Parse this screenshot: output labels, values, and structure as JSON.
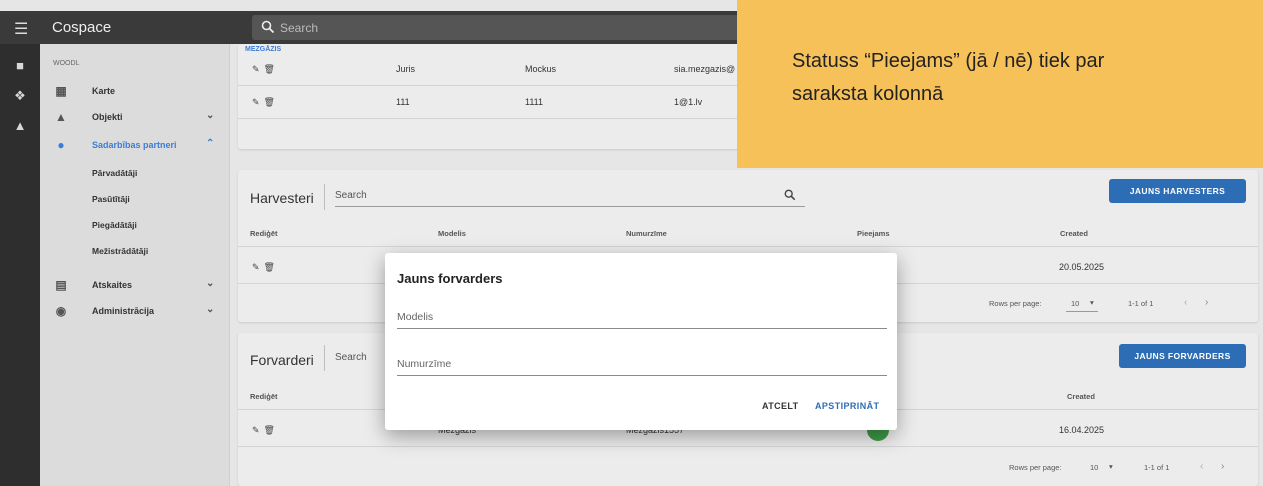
{
  "app": {
    "title": "Cospace",
    "search_placeholder": "Search"
  },
  "sidebar": {
    "org": "WOODL",
    "items": [
      {
        "label": "Karte",
        "icon": "map-icon"
      },
      {
        "label": "Objekti",
        "icon": "tree-icon"
      },
      {
        "label": "Sadarbības partneri",
        "icon": "partners-icon"
      },
      {
        "label": "Atskaites",
        "icon": "report-icon"
      },
      {
        "label": "Administrācija",
        "icon": "account-icon"
      }
    ],
    "subitems": [
      "Pārvadātāji",
      "Pasūtītāji",
      "Piegādātāji",
      "Mežistrādātāji"
    ]
  },
  "top_table": {
    "group_label": "MEZGĀZIS",
    "rows": [
      {
        "c1": "Juris",
        "c2": "Mockus",
        "c3": "sia.mezgazis@"
      },
      {
        "c1": "111",
        "c2": "1111",
        "c3": "1@1.lv"
      }
    ]
  },
  "harvesteri": {
    "title": "Harvesteri",
    "search": "Search",
    "button": "JAUNS HARVESTERS",
    "headers": {
      "edit": "Rediģēt",
      "model": "Modelis",
      "number": "Numurzīme",
      "available": "Pieejams",
      "created": "Created"
    },
    "rows": [
      {
        "created": "20.05.2025"
      }
    ],
    "pager": {
      "rows_per_page": "Rows per page:",
      "value": "10",
      "range": "1-1 of 1"
    }
  },
  "forvarderi": {
    "title": "Forvarderi",
    "search": "Search",
    "button": "JAUNS FORVARDERS",
    "headers": {
      "edit": "Rediģēt",
      "created": "Created"
    },
    "rows": [
      {
        "model": "Mezgazis",
        "number": "Mezgazis1557",
        "created": "16.04.2025"
      }
    ],
    "pager": {
      "rows_per_page": "Rows per page:",
      "value": "10",
      "range": "1-1 of 1"
    }
  },
  "dialog": {
    "title": "Jauns forvarders",
    "field_model": "Modelis",
    "field_number": "Numurzīme",
    "cancel": "ATCELT",
    "confirm": "APSTIPRINĀT"
  },
  "callout": {
    "line1": "Statuss “Pieejams” (jā / nē) tiek par",
    "line2": "saraksta kolonnā"
  },
  "colors": {
    "primary": "#2d6db5",
    "accent_link": "#3b7dd8",
    "callout_bg": "#f7c15a",
    "status_green": "#3e9b48"
  }
}
